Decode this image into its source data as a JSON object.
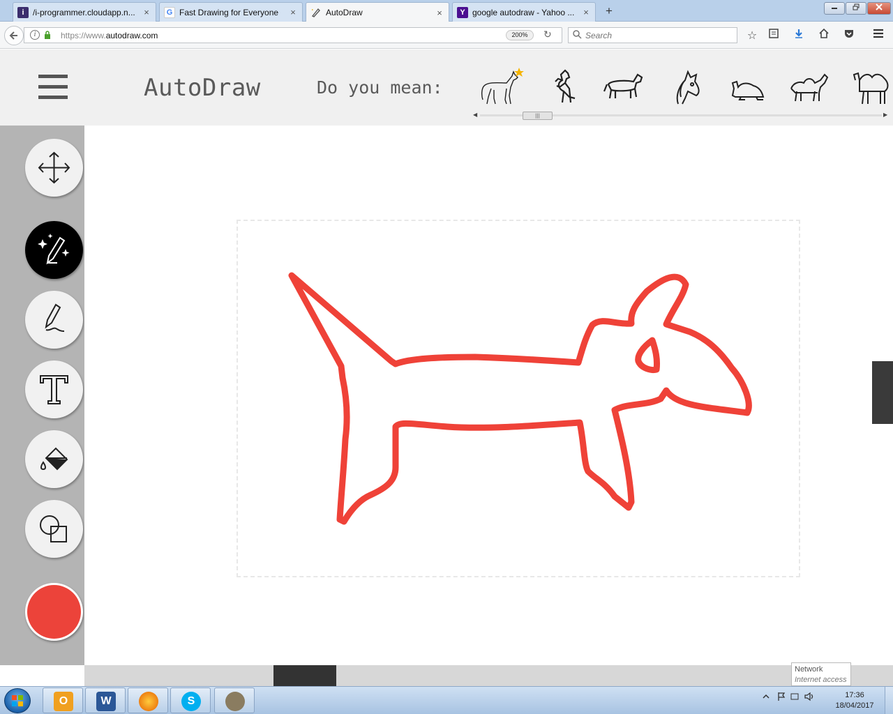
{
  "browser": {
    "tabs": [
      {
        "label": "/i-programmer.cloudapp.n...",
        "favicon_icon": "i-programmer-icon"
      },
      {
        "label": "Fast Drawing for Everyone",
        "favicon_icon": "google-icon"
      },
      {
        "label": "AutoDraw",
        "favicon_icon": "autodraw-icon",
        "active": true
      },
      {
        "label": "google autodraw - Yahoo ...",
        "favicon_icon": "yahoo-icon"
      }
    ],
    "new_tab_label": "+",
    "close_glyph": "×",
    "url_prefix": "https://www.",
    "url_domain": "autodraw.com",
    "zoom": "200%",
    "search_placeholder": "Search"
  },
  "autodraw": {
    "brand": "AutoDraw",
    "suggest_prompt": "Do you mean:",
    "suggestions": [
      "horse",
      "rearing-horse",
      "pony",
      "horse-head",
      "camel-resting",
      "camel",
      "camel-standing"
    ],
    "selected_color": "#ec433a",
    "stroke_color": "#ef4238"
  },
  "tools": [
    "move-tool",
    "autodraw-tool",
    "draw-tool",
    "text-tool",
    "fill-tool",
    "shape-tool"
  ],
  "tooltip": {
    "line1": "Network",
    "line2": "Internet access"
  },
  "taskbar": {
    "apps": [
      "outlook",
      "word",
      "firefox",
      "skype",
      "gimp"
    ],
    "time": "17:36",
    "date": "18/04/2017"
  }
}
